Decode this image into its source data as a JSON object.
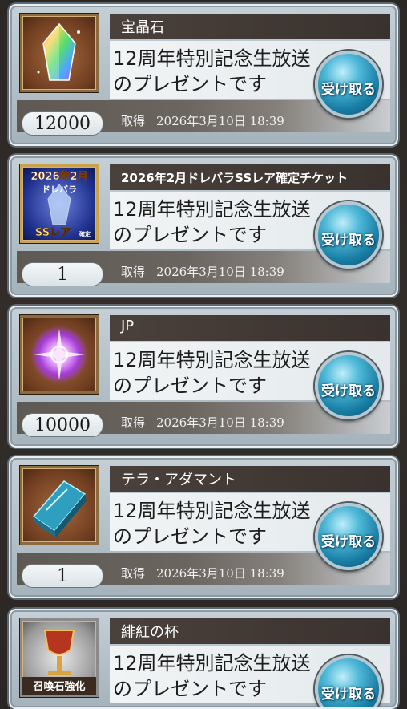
{
  "receive_label": "受け取る",
  "acquired_label": "取得",
  "items": [
    {
      "name": "宝晶石",
      "message": "12周年特別記念生放送のプレゼントです",
      "quantity": "12000",
      "datetime": "2026年3月10日 18:39",
      "icon": "crystal-icon"
    },
    {
      "name": "2026年2月ドレバラSSレア確定チケット",
      "message": "12周年特別記念生放送のプレゼントです",
      "quantity": "1",
      "datetime": "2026年3月10日 18:39",
      "icon": "ticket-icon",
      "icon_text_line1": "2026年2月",
      "icon_text_line2": "ドレバラ",
      "icon_text_line3": "SSレア",
      "icon_text_line4": "確定"
    },
    {
      "name": "JP",
      "message": "12周年特別記念生放送のプレゼントです",
      "quantity": "10000",
      "datetime": "2026年3月10日 18:39",
      "icon": "jp-orb-icon"
    },
    {
      "name": "テラ・アダマント",
      "message": "12周年特別記念生放送のプレゼントです",
      "quantity": "1",
      "datetime": "2026年3月10日 18:39",
      "icon": "ingot-icon"
    },
    {
      "name": "緋紅の杯",
      "message": "12周年特別記念生放送のプレゼントです",
      "quantity": "",
      "datetime": "",
      "icon": "chalice-icon",
      "icon_text": "召喚石強化"
    }
  ]
}
